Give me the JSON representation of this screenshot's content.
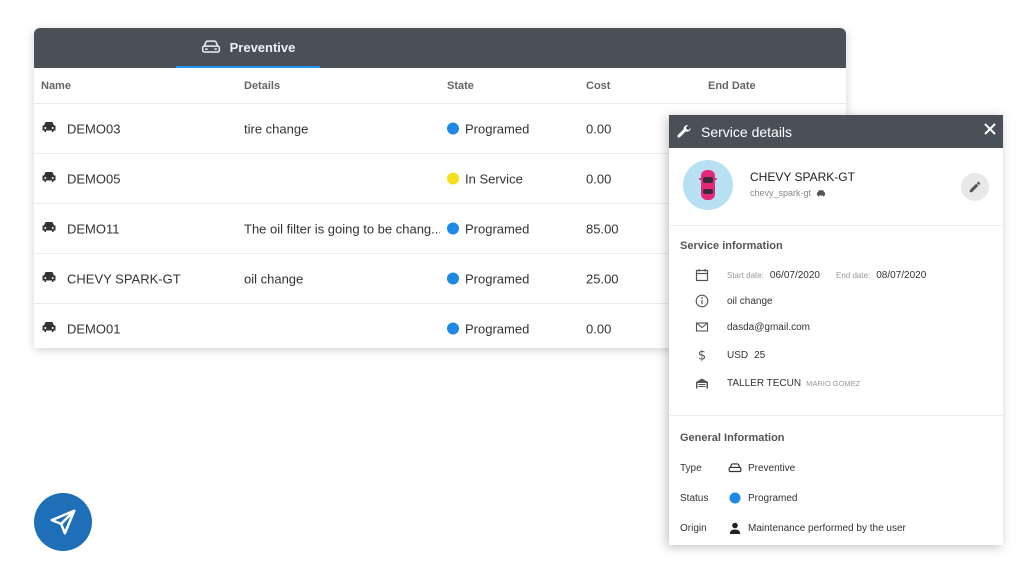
{
  "tab": {
    "label": "Preventive"
  },
  "table": {
    "headers": [
      "Name",
      "Details",
      "State",
      "Cost",
      "End Date"
    ],
    "rows": [
      {
        "name": "DEMO03",
        "details": "tire change",
        "state": "Programed",
        "state_color": "#1e88e5",
        "cost": "0.00"
      },
      {
        "name": "DEMO05",
        "details": "",
        "state": "In Service",
        "state_color": "#f5e11b",
        "cost": "0.00"
      },
      {
        "name": "DEMO11",
        "details": "The oil filter is going to be chang...",
        "state": "Programed",
        "state_color": "#1e88e5",
        "cost": "85.00"
      },
      {
        "name": "CHEVY SPARK-GT",
        "details": "oil change",
        "state": "Programed",
        "state_color": "#1e88e5",
        "cost": "25.00"
      },
      {
        "name": "DEMO01",
        "details": "",
        "state": "Programed",
        "state_color": "#1e88e5",
        "cost": "0.00"
      }
    ]
  },
  "panel": {
    "title": "Service details",
    "vehicle": {
      "name": "CHEVY SPARK-GT",
      "sub": "chevy_spark-gt"
    },
    "service_info": {
      "title": "Service information",
      "start_label": "Start date:",
      "start_date": "06/07/2020",
      "end_label": "End date:",
      "end_date": "08/07/2020",
      "details": "oil change",
      "email": "dasda@gmail.com",
      "currency": "USD",
      "amount": "25",
      "workshop": "TALLER TECUN",
      "mechanic": "MARIO GOMEZ"
    },
    "general_info": {
      "title": "General Information",
      "type_label": "Type",
      "type_value": "Preventive",
      "status_label": "Status",
      "status_value": "Programed",
      "origin_label": "Origin",
      "origin_value": "Maintenance performed by the user"
    }
  },
  "colors": {
    "header": "#4a5058",
    "accent": "#2196f3",
    "programed": "#1e88e5",
    "in_service": "#f5e11b",
    "nav": "#1e6fb8"
  }
}
